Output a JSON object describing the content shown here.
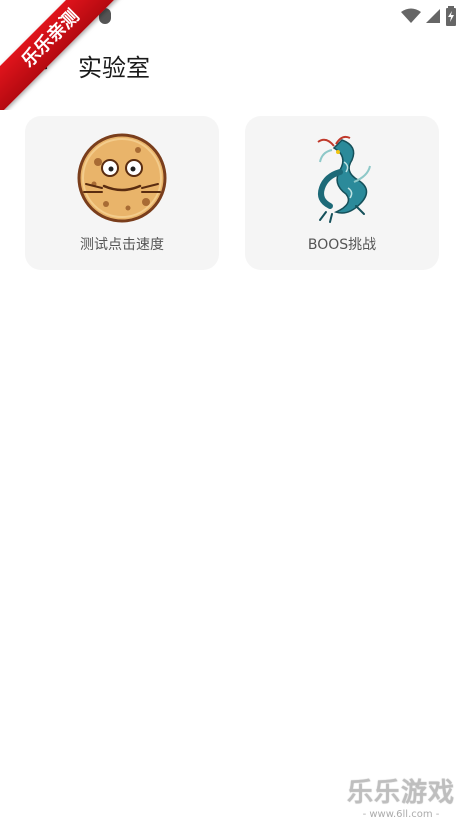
{
  "watermark_ribbon": "乐乐亲测",
  "toolbar": {
    "title": "实验室",
    "back_icon": "arrow-left-icon"
  },
  "status_bar": {
    "icons": [
      "wifi-icon",
      "signal-icon",
      "battery-charging-icon"
    ]
  },
  "cards": [
    {
      "label": "测试点击速度",
      "icon": "cookie-face-icon"
    },
    {
      "label": "BOOS挑战",
      "icon": "dragon-icon"
    }
  ],
  "watermark_footer": {
    "main": "乐乐游戏",
    "sub": "- www.6ll.com -"
  },
  "colors": {
    "card_bg": "#f5f5f5",
    "ribbon": "#d4121a",
    "cookie": "#e9b46a",
    "dragon": "#2b8a9a"
  }
}
